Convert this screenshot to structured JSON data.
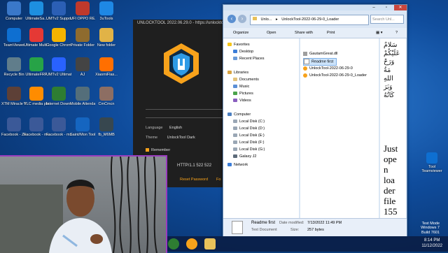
{
  "desktop_icons": [
    {
      "label": "Computer",
      "color": "#3a78c9"
    },
    {
      "label": "UltimateSa...",
      "color": "#1d8fe0"
    },
    {
      "label": "UMTv2 Support...",
      "color": "#2b5fb5"
    },
    {
      "label": "UFI OPPO REALME M...",
      "color": "#c0392b"
    },
    {
      "label": "3uTools",
      "color": "#1e88e5"
    },
    {
      "label": "TeamViewer",
      "color": "#0e6fd1"
    },
    {
      "label": "Ultimate Multi Too...",
      "color": "#e53935"
    },
    {
      "label": "Google Chrome",
      "color": "#f4b400"
    },
    {
      "label": "Private Folder",
      "color": "#8e6b2e"
    },
    {
      "label": "New folder",
      "color": "#e1b347"
    },
    {
      "label": "Recycle Bin",
      "color": "#607d8b"
    },
    {
      "label": "UltimateFRP",
      "color": "#27a347"
    },
    {
      "label": "UMTv2 UltimateMTK",
      "color": "#2962ff"
    },
    {
      "label": "AJ",
      "color": "#444444"
    },
    {
      "label": "XiaomiFlas...",
      "color": "#ff6f00"
    },
    {
      "label": "XTM Miracle Thunder 2.82",
      "color": "#5d4037"
    },
    {
      "label": "VLC media player",
      "color": "#ff8c00"
    },
    {
      "label": "Internet Download...",
      "color": "#2e7d32"
    },
    {
      "label": "Mobile Attendance",
      "color": "#546e7a"
    },
    {
      "label": "CmCmcn",
      "color": "#8d6e63"
    },
    {
      "label": "Facebook - ZaidnMahi...",
      "color": "#3b5998"
    },
    {
      "label": "Facebook - muntasir12...",
      "color": "#3b5998"
    },
    {
      "label": "Facebook - muhammadst...",
      "color": "#3b5998"
    },
    {
      "label": "Saint/Mon Tool Bra...",
      "color": "#1565c0"
    },
    {
      "label": "fb_M6MB",
      "color": "#37474f"
    }
  ],
  "unlocktool": {
    "title": "UNLOCKTOOL 2022.06.29.0 - https://unlocktool.net",
    "language_label": "Language",
    "language_value": "English",
    "theme_label": "Theme",
    "theme_value": "UnlockTool Dark",
    "remember_label": "Remember",
    "http_status": "HTTP/1.1 522 522",
    "reset_password": "Reset Password",
    "forgot_fragment": "Fo"
  },
  "explorer": {
    "address_segments": [
      "Unlo...",
      "UnlockTool-2022-06-29-0_Loader"
    ],
    "search_placeholder": "Search Unl...",
    "toolbar": {
      "organize": "Organize",
      "open": "Open",
      "share_with": "Share with",
      "print": "Print"
    },
    "nav": {
      "favorites": "Favorites",
      "desktop": "Desktop",
      "recent_places": "Recent Places",
      "libraries": "Libraries",
      "documents": "Documents",
      "music": "Music",
      "pictures": "Pictures",
      "videos": "Videos",
      "computer": "Computer",
      "drives": [
        "Local Disk (C:)",
        "Local Disk (D:)",
        "Local Disk (E:)",
        "Local Disk (F:)",
        "Local Disk (G:)",
        "Galaxy J2"
      ],
      "network": "Network"
    },
    "files": [
      {
        "name": "GautamGreat.dll",
        "color": "#9e9e9e"
      },
      {
        "name": "Readme first",
        "color": "#ffffff"
      },
      {
        "name": "UnlockTool-2022-06-29-0",
        "color": "#f7a21b"
      },
      {
        "name": "UnlockTool-2022-06-29-0_Loader",
        "color": "#f7a21b"
      }
    ],
    "preview_arabic": [
      "سَلامٌ",
      "عَلَيْكُمْ",
      "وَرَحْ",
      "مَةُ",
      "اللهِ",
      "وَبَرَ",
      "كَاتُهُ"
    ],
    "preview_text": [
      "Just",
      "ope",
      "n",
      "loa",
      "der",
      "file",
      "155"
    ],
    "details": {
      "name": "Readme first",
      "type": "Text Document",
      "modified_label": "Date modified:",
      "modified_value": "7/13/2022 11:49 PM",
      "size_label": "Size:",
      "size_value": "257 bytes"
    }
  },
  "right_icon": {
    "label": "Tool Teamviewer"
  },
  "watermark": {
    "line1": "Test Mode",
    "line2": "Windows 7",
    "line3": "Build 7601"
  },
  "clock": {
    "time": "8:14 PM",
    "date": "11/12/2022"
  }
}
